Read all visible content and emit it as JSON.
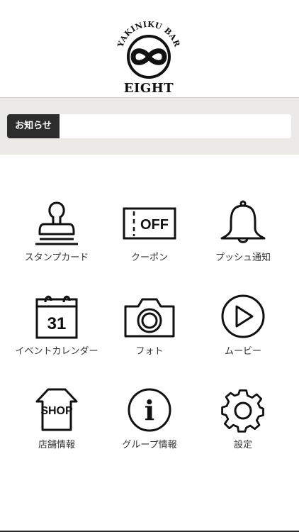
{
  "logo": {
    "arc_text": "YAKINIKU BAR",
    "name": "EIGHT"
  },
  "notice": {
    "label": "お知らせ",
    "text": ""
  },
  "menu": {
    "items": [
      {
        "label": "スタンプカード",
        "icon": "stamp-icon"
      },
      {
        "label": "クーポン",
        "icon": "coupon-icon",
        "icon_text": "OFF"
      },
      {
        "label": "プッシュ通知",
        "icon": "bell-icon"
      },
      {
        "label": "イベントカレンダー",
        "icon": "calendar-icon",
        "icon_text": "31"
      },
      {
        "label": "フォト",
        "icon": "camera-icon"
      },
      {
        "label": "ムービー",
        "icon": "play-icon"
      },
      {
        "label": "店舗情報",
        "icon": "shop-icon",
        "icon_text": "SHOP"
      },
      {
        "label": "グループ情報",
        "icon": "info-icon",
        "icon_text": "i"
      },
      {
        "label": "設定",
        "icon": "gear-icon"
      }
    ]
  }
}
